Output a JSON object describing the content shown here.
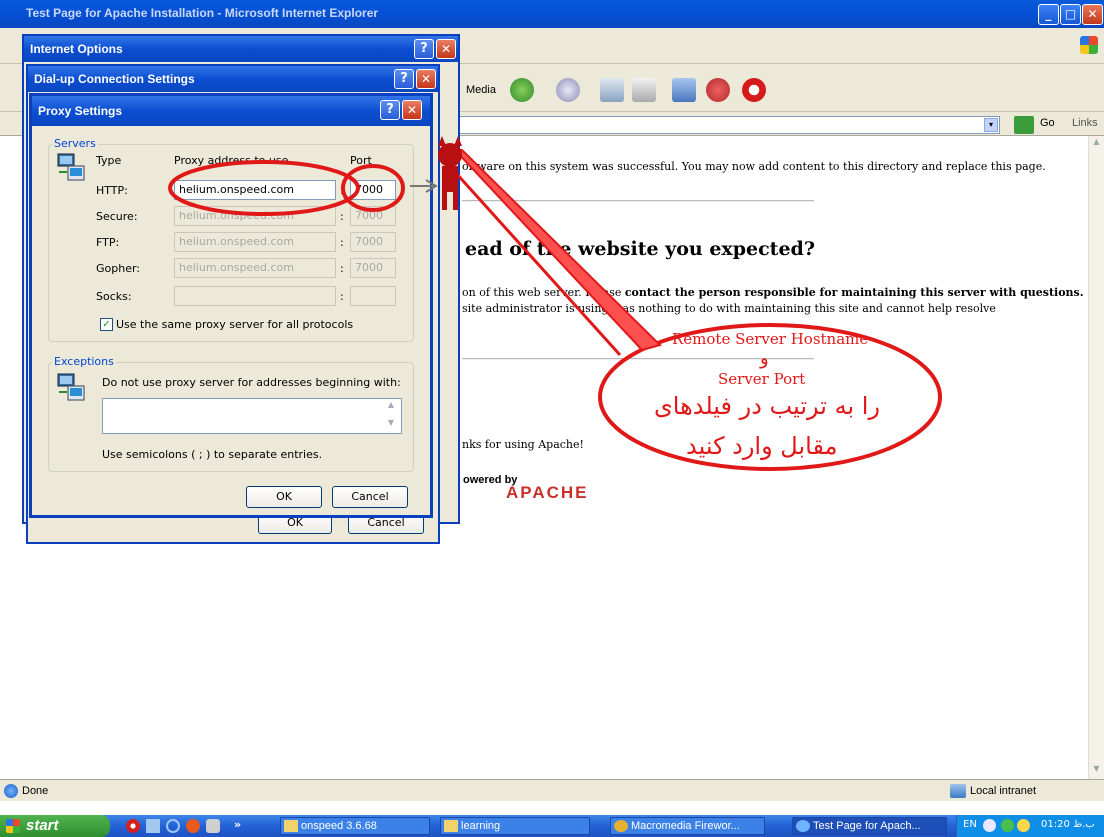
{
  "browser": {
    "title": "Test Page for Apache Installation - Microsoft Internet Explorer",
    "toolbar": {
      "media_label": "Media"
    },
    "address": {
      "go_label": "Go",
      "links_label": "Links"
    },
    "status": {
      "left": "Done",
      "zone": "Local intranet"
    }
  },
  "content": {
    "line1": "oftware on this system was successful. You may now add content to this directory and replace this page.",
    "heading": "ead of the website you expected?",
    "para_a": "on of this web server. Please ",
    "para_bold": "contact the person responsible for maintaining this server with questions.",
    "para_line2": "site administrator is using, has nothing to do with maintaining this site and cannot help resolve",
    "thanks": "nks for using Apache!",
    "powered_by": "owered by",
    "apache": "APACHE"
  },
  "dialogs": {
    "internet_options": {
      "title": "Internet Options"
    },
    "dialup": {
      "title": "Dial-up Connection Settings",
      "ok": "OK",
      "cancel": "Cancel"
    },
    "proxy": {
      "title": "Proxy Settings",
      "servers_group": "Servers",
      "col_type": "Type",
      "col_address": "Proxy address to use",
      "col_port": "Port",
      "rows": [
        {
          "type": "HTTP:",
          "address": "helium.onspeed.com",
          "port": "7000"
        },
        {
          "type": "Secure:",
          "address": "helium.onspeed.com",
          "port": "7000"
        },
        {
          "type": "FTP:",
          "address": "helium.onspeed.com",
          "port": "7000"
        },
        {
          "type": "Gopher:",
          "address": "helium.onspeed.com",
          "port": "7000"
        },
        {
          "type": "Socks:",
          "address": "",
          "port": ""
        }
      ],
      "same_proxy_label": "Use the same proxy server for all protocols",
      "same_proxy_checked": true,
      "exceptions_group": "Exceptions",
      "exceptions_desc": "Do not use proxy server for addresses beginning with:",
      "exceptions_value": "",
      "semicolon_hint": "Use semicolons ( ; ) to separate entries.",
      "ok": "OK",
      "cancel": "Cancel"
    }
  },
  "annotation": {
    "line1": "Remote Server Hostname",
    "line2": "و",
    "line3": "Server Port",
    "line4": "را به ترتیب در فیلدهای",
    "line5": "مقابل وارد کنید",
    "color": "#e01818"
  },
  "taskbar": {
    "start": "start",
    "items": [
      {
        "label": "onspeed 3.6.68"
      },
      {
        "label": "learning"
      },
      {
        "label": "Macromedia Firewor..."
      },
      {
        "label": "Test Page for Apach..."
      }
    ],
    "lang": "EN",
    "clock": "01:20 ب.ظ"
  }
}
